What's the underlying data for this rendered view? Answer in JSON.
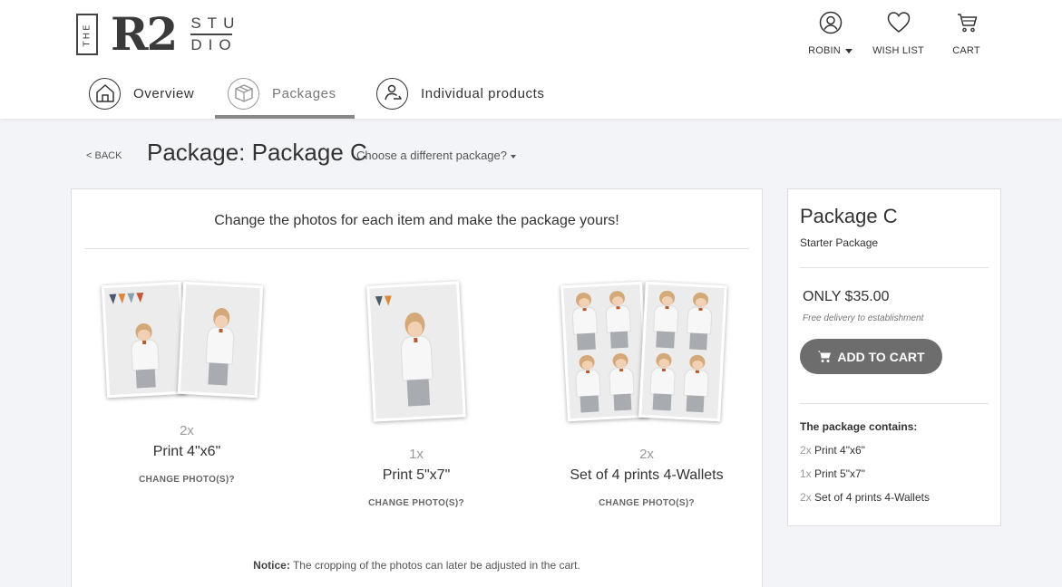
{
  "logo": {
    "the": "THE",
    "mark": "R2",
    "studio_top": "STU",
    "studio_bottom": "DIO"
  },
  "header_actions": [
    {
      "label": "ROBIN",
      "icon": "user-icon"
    },
    {
      "label": "WISH LIST",
      "icon": "heart-icon"
    },
    {
      "label": "CART",
      "icon": "cart-icon"
    }
  ],
  "tabs": [
    {
      "label": "Overview",
      "icon": "home-icon",
      "active": false
    },
    {
      "label": "Packages",
      "icon": "box-icon",
      "active": true
    },
    {
      "label": "Individual products",
      "icon": "person-product-icon",
      "active": false
    }
  ],
  "page": {
    "back_label": "< BACK",
    "title": "Package: Package C",
    "choose_label": "Choose a different package?"
  },
  "panel": {
    "intro": "Change the photos for each item and make the package yours!",
    "notice_bold": "Notice:",
    "notice_text": " The cropping of the photos can later be adjusted in the cart.",
    "items": [
      {
        "qty": "2x",
        "name": "Print 4\"x6\"",
        "change_label": "CHANGE PHOTO(S)?"
      },
      {
        "qty": "1x",
        "name": "Print 5\"x7\"",
        "change_label": "CHANGE PHOTO(S)?"
      },
      {
        "qty": "2x",
        "name": "Set of 4 prints 4-Wallets",
        "change_label": "CHANGE PHOTO(S)?"
      }
    ]
  },
  "sidebar": {
    "title": "Package C",
    "subtitle": "Starter Package",
    "price": "ONLY $35.00",
    "delivery": "Free delivery to establishment",
    "add_to_cart": "ADD TO CART",
    "contains_heading": "The package contains:",
    "contents": [
      {
        "qty": "2x",
        "name": "Print 4\"x6\""
      },
      {
        "qty": "1x",
        "name": "Print 5\"x7\""
      },
      {
        "qty": "2x",
        "name": "Set of 4 prints 4-Wallets"
      }
    ]
  },
  "colors": {
    "button": "#6d6d6d",
    "page_bg": "#f3f4f7",
    "active_tab": "#888888"
  }
}
